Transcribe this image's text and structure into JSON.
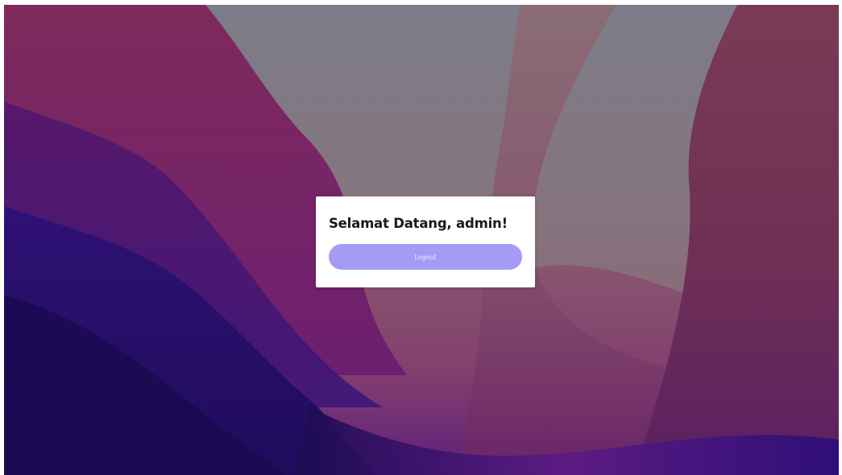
{
  "card": {
    "greeting": "Selamat Datang, admin!",
    "logout_label": "Logout"
  },
  "colors": {
    "button": "#a49cf4",
    "card_background": "#ffffff",
    "wallpaper_top": "#7c7c86",
    "wallpaper_left": "#2a0f6e",
    "wallpaper_right": "#743552"
  }
}
